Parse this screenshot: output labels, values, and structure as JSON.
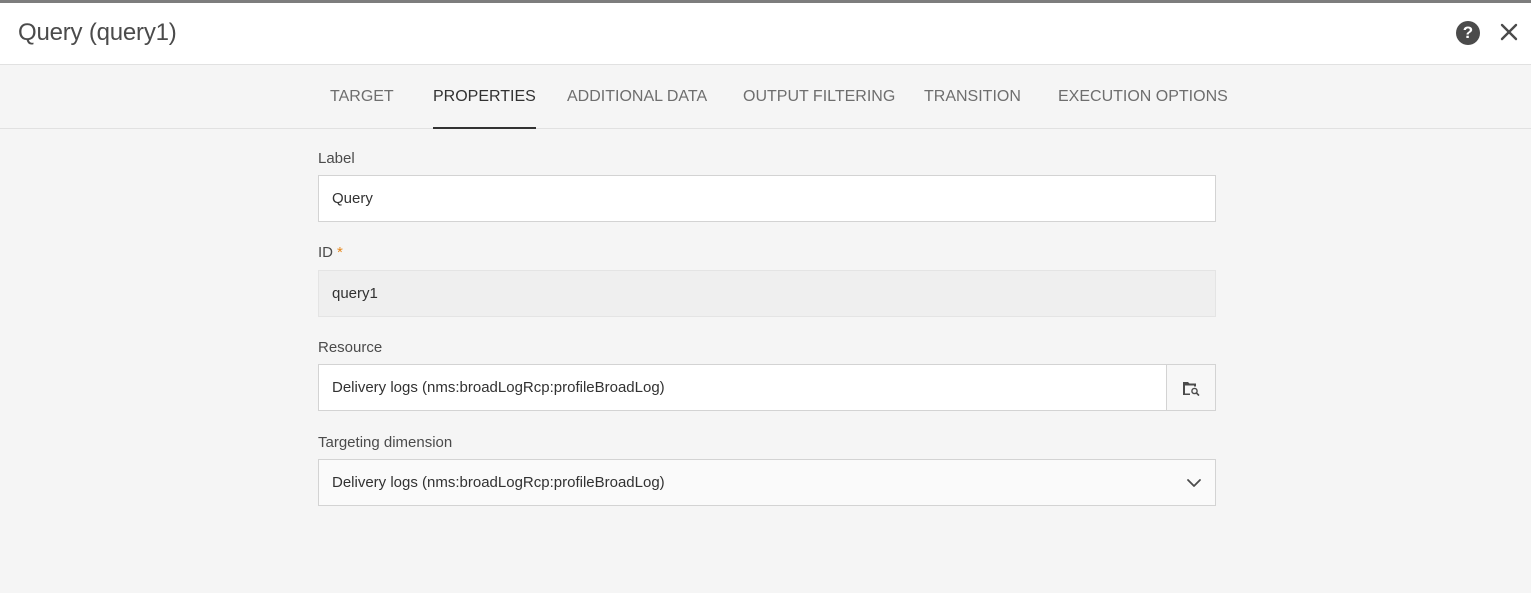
{
  "dialog": {
    "title": "Query (query1)"
  },
  "tabs": [
    {
      "label": "TARGET",
      "active": false
    },
    {
      "label": "PROPERTIES",
      "active": true
    },
    {
      "label": "ADDITIONAL DATA",
      "active": false
    },
    {
      "label": "OUTPUT FILTERING",
      "active": false
    },
    {
      "label": "TRANSITION",
      "active": false
    },
    {
      "label": "EXECUTION OPTIONS",
      "active": false
    }
  ],
  "form": {
    "label": {
      "label": "Label",
      "value": "Query"
    },
    "id": {
      "label": "ID",
      "required_mark": "*",
      "value": "query1"
    },
    "resource": {
      "label": "Resource",
      "value": "Delivery logs (nms:broadLogRcp:profileBroadLog)"
    },
    "targeting_dimension": {
      "label": "Targeting dimension",
      "value": "Delivery logs (nms:broadLogRcp:profileBroadLog)"
    }
  },
  "icons": {
    "help": "help-icon",
    "close": "close-icon",
    "resource_picker": "folder-search-icon",
    "dropdown": "chevron-down-icon"
  },
  "colors": {
    "required": "#e68619",
    "active_tab_underline": "#323232"
  }
}
